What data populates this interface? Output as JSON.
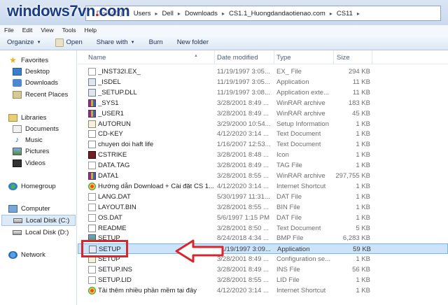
{
  "watermark": {
    "text": "windows7vn.com"
  },
  "address": {
    "crumbs": [
      "l Disk (C:)",
      "Users",
      "Dell",
      "Downloads",
      "CS1.1_Huongdandaotienao.com",
      "CS11"
    ]
  },
  "menu": {
    "items": [
      "File",
      "Edit",
      "View",
      "Tools",
      "Help"
    ]
  },
  "toolbar": {
    "organize": "Organize",
    "open": "Open",
    "share_with": "Share with",
    "burn": "Burn",
    "new_folder": "New folder"
  },
  "nav": {
    "favorites": "Favorites",
    "desktop": "Desktop",
    "downloads": "Downloads",
    "recent_places": "Recent Places",
    "libraries": "Libraries",
    "documents": "Documents",
    "music": "Music",
    "pictures": "Pictures",
    "videos": "Videos",
    "homegroup": "Homegroup",
    "computer": "Computer",
    "local_disk_c": "Local Disk (C:)",
    "local_disk_d": "Local Disk (D:)",
    "network": "Network"
  },
  "columns": {
    "name": "Name",
    "date": "Date modified",
    "type": "Type",
    "size": "Size"
  },
  "files": [
    {
      "name": "_INST32I.EX_",
      "date": "11/19/1997 3:05...",
      "type": "EX_ File",
      "size": "294 KB",
      "icon": "file"
    },
    {
      "name": "_ISDEL",
      "date": "11/19/1997 3:05...",
      "type": "Application",
      "size": "11 KB",
      "icon": "app"
    },
    {
      "name": "_SETUP.DLL",
      "date": "11/19/1997 3:08...",
      "type": "Application exte...",
      "size": "11 KB",
      "icon": "app"
    },
    {
      "name": "_SYS1",
      "date": "3/28/2001 8:49 ...",
      "type": "WinRAR archive",
      "size": "183 KB",
      "icon": "rar"
    },
    {
      "name": "_USER1",
      "date": "3/28/2001 8:49 ...",
      "type": "WinRAR archive",
      "size": "45 KB",
      "icon": "rar"
    },
    {
      "name": "AUTORUN",
      "date": "3/29/2000 10:54...",
      "type": "Setup Information",
      "size": "1 KB",
      "icon": "info"
    },
    {
      "name": "CD-KEY",
      "date": "4/12/2020 3:14 ...",
      "type": "Text Document",
      "size": "1 KB",
      "icon": "text"
    },
    {
      "name": "chuyen doi haft life",
      "date": "1/16/2007 12:53...",
      "type": "Text Document",
      "size": "1 KB",
      "icon": "text"
    },
    {
      "name": "CSTRIKE",
      "date": "3/28/2001 8:48 ...",
      "type": "Icon",
      "size": "1 KB",
      "icon": "icon"
    },
    {
      "name": "DATA.TAG",
      "date": "3/28/2001 8:49 ...",
      "type": "TAG File",
      "size": "1 KB",
      "icon": "file"
    },
    {
      "name": "DATA1",
      "date": "3/28/2001 8:55 ...",
      "type": "WinRAR archive",
      "size": "297,755 KB",
      "icon": "rar"
    },
    {
      "name": "Hướng dẫn Download + Cài đặt CS 1...",
      "date": "4/12/2020 3:14 ...",
      "type": "Internet Shortcut",
      "size": "1 KB",
      "icon": "web"
    },
    {
      "name": "LANG.DAT",
      "date": "5/30/1997 11:31...",
      "type": "DAT File",
      "size": "1 KB",
      "icon": "file"
    },
    {
      "name": "LAYOUT.BIN",
      "date": "3/28/2001 8:55 ...",
      "type": "BIN File",
      "size": "1 KB",
      "icon": "file"
    },
    {
      "name": "OS.DAT",
      "date": "5/6/1997 1:15 PM",
      "type": "DAT File",
      "size": "1 KB",
      "icon": "file"
    },
    {
      "name": "README",
      "date": "3/28/2001 8:50 ...",
      "type": "Text Document",
      "size": "5 KB",
      "icon": "text"
    },
    {
      "name": "SETUP",
      "date": "8/24/2018 4:34 ...",
      "type": "BMP File",
      "size": "6,283 KB",
      "icon": "bmp"
    },
    {
      "name": "SETUP",
      "date": "11/19/1997 3:09...",
      "type": "Application",
      "size": "59 KB",
      "icon": "setup",
      "selected": true
    },
    {
      "name": "SETUP",
      "date": "3/28/2001 8:49 ...",
      "type": "Configuration se...",
      "size": "1 KB",
      "icon": "info"
    },
    {
      "name": "SETUP.INS",
      "date": "3/28/2001 8:49 ...",
      "type": "INS File",
      "size": "56 KB",
      "icon": "file"
    },
    {
      "name": "SETUP.LID",
      "date": "3/28/2001 8:55 ...",
      "type": "LID File",
      "size": "1 KB",
      "icon": "file"
    },
    {
      "name": "Tải thêm nhiều phần mềm tại đây",
      "date": "4/12/2020 3:14 ...",
      "type": "Internet Shortcut",
      "size": "1 KB",
      "icon": "web"
    }
  ],
  "colors": {
    "highlight_red": "#d7262e",
    "selection_blue": "#cbe4fa"
  }
}
